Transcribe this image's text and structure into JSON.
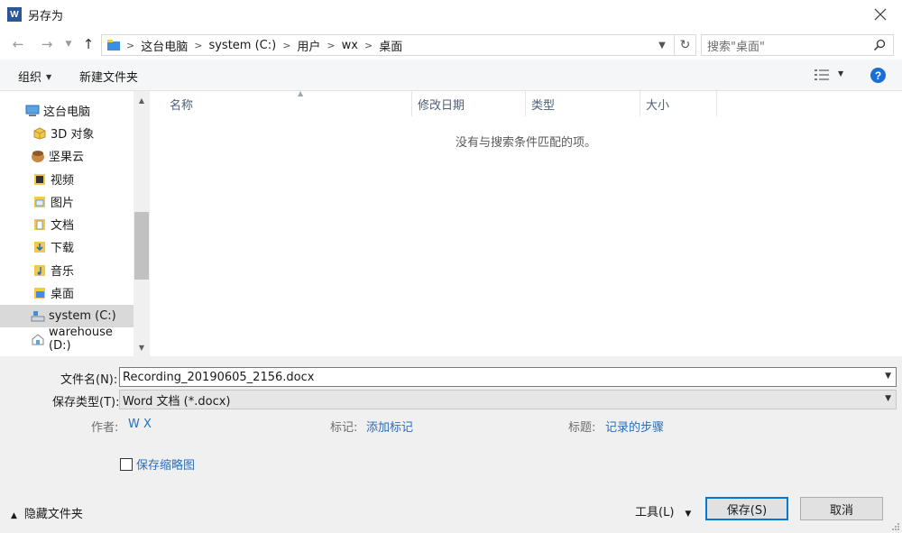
{
  "window": {
    "app_icon": "W",
    "title": "另存为"
  },
  "address_bar": {
    "crumbs": [
      "这台电脑",
      "system (C:)",
      "用户",
      "wx",
      "桌面"
    ],
    "search_placeholder": "搜索\"桌面\""
  },
  "toolbar": {
    "organize": "组织",
    "new_folder": "新建文件夹",
    "help": "?"
  },
  "nav": {
    "items": [
      {
        "label": "这台电脑",
        "icon": "computer-icon"
      },
      {
        "label": "3D 对象",
        "icon": "3d-objects-icon"
      },
      {
        "label": "坚果云",
        "icon": "nutstore-icon"
      },
      {
        "label": "视频",
        "icon": "videos-icon"
      },
      {
        "label": "图片",
        "icon": "pictures-icon"
      },
      {
        "label": "文档",
        "icon": "documents-icon"
      },
      {
        "label": "下载",
        "icon": "downloads-icon"
      },
      {
        "label": "音乐",
        "icon": "music-icon"
      },
      {
        "label": "桌面",
        "icon": "desktop-icon"
      },
      {
        "label": "system (C:)",
        "icon": "drive-c-icon"
      },
      {
        "label": "warehouse (D:)",
        "icon": "drive-d-icon"
      }
    ],
    "selected": "system (C:)"
  },
  "columns": [
    "名称",
    "修改日期",
    "类型",
    "大小"
  ],
  "empty_message": "没有与搜索条件匹配的项。",
  "form": {
    "filename_label": "文件名(N):",
    "filename_value": "Recording_20190605_2156.docx",
    "filetype_label": "保存类型(T):",
    "filetype_value": "Word 文档 (*.docx)",
    "author_label": "作者:",
    "author_value": "W X",
    "tags_label": "标记:",
    "tags_value": "添加标记",
    "title_label": "标题:",
    "title_value": "记录的步骤",
    "thumbnail_label": "保存缩略图",
    "thumbnail_checked": false
  },
  "footer": {
    "hide_folders": "隐藏文件夹",
    "tools": "工具(L)",
    "save": "保存(S)",
    "cancel": "取消"
  },
  "colors": {
    "accent": "#0078d7",
    "link": "#2a6ebb",
    "header_text": "#4c607a"
  }
}
